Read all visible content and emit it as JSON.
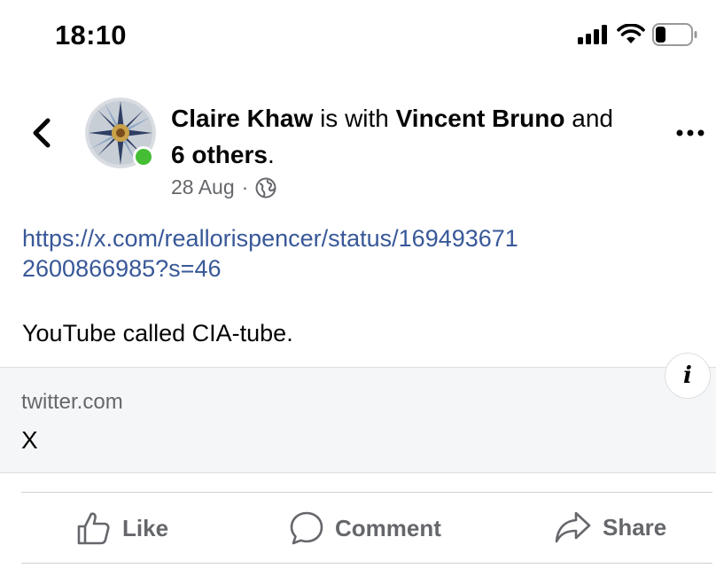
{
  "status_bar": {
    "time": "18:10"
  },
  "post": {
    "author": "Claire Khaw",
    "with_text": "is with",
    "tagged": "Vincent Bruno",
    "and_text": "and",
    "others": "6 others",
    "period": ".",
    "date": "28 Aug",
    "separator": "·",
    "privacy_icon": "globe-icon",
    "link_url": "https://x.com/reallorispencer/status/1694936712600866985?s=46",
    "text": "YouTube called CIA-tube."
  },
  "link_preview": {
    "domain": "twitter.com",
    "title": "X",
    "info_icon": "i"
  },
  "actions": {
    "like": "Like",
    "comment": "Comment",
    "share": "Share"
  },
  "colors": {
    "link": "#385898",
    "secondary_text": "#65676b",
    "online": "#45bd34",
    "preview_bg": "#f5f6f7"
  }
}
